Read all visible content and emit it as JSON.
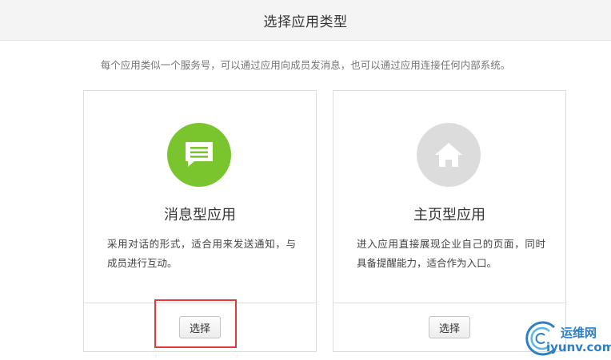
{
  "header": {
    "title": "选择应用类型"
  },
  "description": "每个应用类似一个服务号，可以通过应用向成员发消息，也可以通过应用连接任何内部系统。",
  "cards": [
    {
      "title": "消息型应用",
      "desc": "采用对话的形式，适合用来发送通知，与成员进行互动。",
      "button": "选择",
      "icon": "chat-message-icon",
      "icon_color": "#7ac52d"
    },
    {
      "title": "主页型应用",
      "desc": "进入应用直接展现企业自己的页面，同时具备提醒能力，适合作为入口。",
      "button": "选择",
      "icon": "home-icon",
      "icon_color": "#dcdcdc"
    }
  ],
  "highlight_color": "#e03a3a",
  "watermark": {
    "cn": "运维网",
    "en": "iyunv.com"
  }
}
